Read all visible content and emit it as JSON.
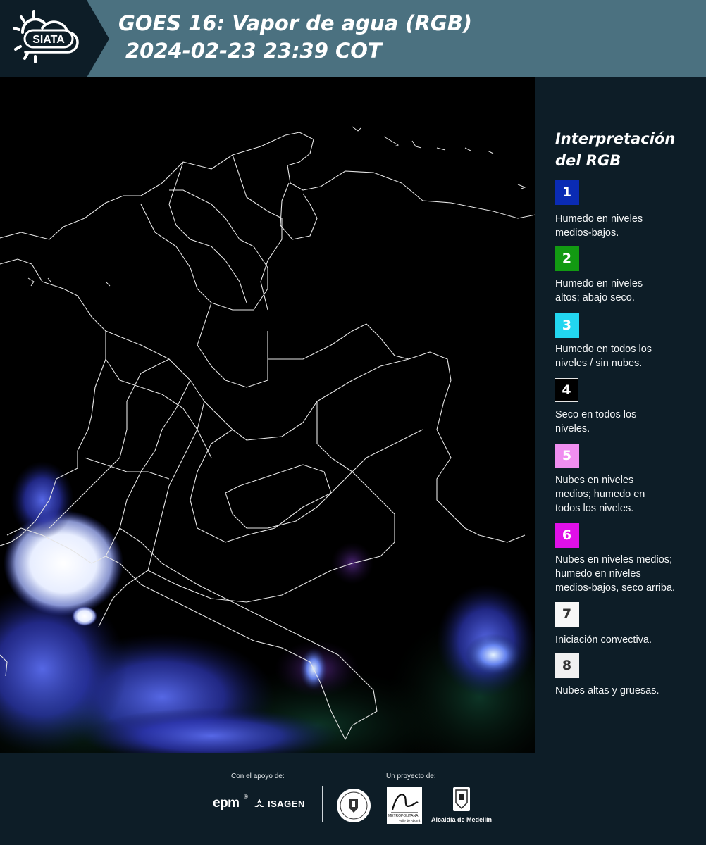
{
  "header": {
    "logo_text": "SIATA",
    "title_line1": "GOES 16: Vapor de agua (RGB)",
    "title_line2": "2024-02-23 23:39 COT"
  },
  "legend": {
    "title_line1": "Interpretación",
    "title_line2": "del RGB",
    "items": [
      {
        "number": "1",
        "color": "#0a2bb4",
        "text_color": "#ffffff",
        "line1": "Humedo en niveles",
        "line2": "medios-bajos.",
        "line3": ""
      },
      {
        "number": "2",
        "color": "#129a12",
        "text_color": "#ffffff",
        "line1": "Humedo en niveles",
        "line2": "altos; abajo seco.",
        "line3": ""
      },
      {
        "number": "3",
        "color": "#22d6f0",
        "text_color": "#ffffff",
        "line1": "Humedo en todos los",
        "line2": "niveles / sin nubes.",
        "line3": ""
      },
      {
        "number": "4",
        "color": "#000000",
        "text_color": "#ffffff",
        "line1": "Seco en todos los",
        "line2": "niveles.",
        "line3": ""
      },
      {
        "number": "5",
        "color": "#f08ef0",
        "text_color": "#ffffff",
        "line1": "Nubes en niveles",
        "line2": "medios; humedo en",
        "line3": "todos los niveles."
      },
      {
        "number": "6",
        "color": "#e010e8",
        "text_color": "#ffffff",
        "line1": "Nubes en niveles medios;",
        "line2": "humedo en niveles",
        "line3": "medios-bajos, seco arriba."
      },
      {
        "number": "7",
        "color": "#f7f7f7",
        "text_color": "#333333",
        "line1": "Iniciación convectiva.",
        "line2": "",
        "line3": ""
      },
      {
        "number": "8",
        "color": "#f0f0f0",
        "text_color": "#333333",
        "line1": "Nubes altas y gruesas.",
        "line2": "",
        "line3": ""
      }
    ]
  },
  "footer": {
    "support_label": "Con el apoyo de:",
    "project_label": "Un proyecto de:",
    "epm_text": "epm",
    "isagen_text": "ISAGEN",
    "metropolitana_text": "METROPOLITANA",
    "metropolitana_sub": "Valle de Aburrá",
    "alcaldia_text": "Alcaldía de Medellín"
  }
}
